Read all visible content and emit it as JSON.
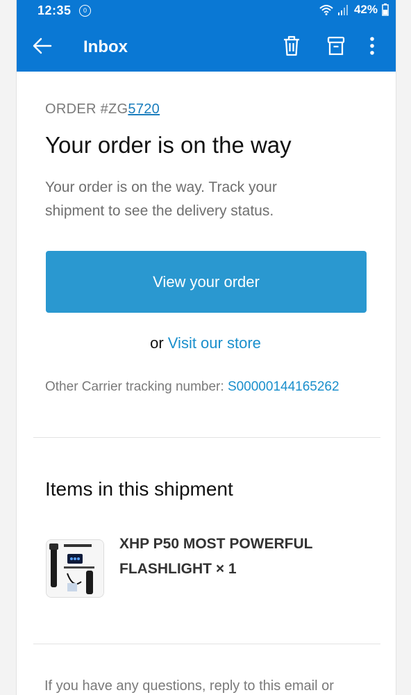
{
  "status_bar": {
    "time": "12:35",
    "notif_badge": "⓪",
    "battery": "42%"
  },
  "appbar": {
    "title": "Inbox",
    "color": "#0a78d4"
  },
  "email": {
    "order_prefix": "ORDER #ZG",
    "order_link": "5720",
    "headline": "Your order is on the way",
    "subtext": "Your order is on the way. Track your shipment to see the delivery status.",
    "button_label": "View your order",
    "or_text": "or",
    "store_link": "Visit our store",
    "tracking_label": "Other Carrier tracking number:",
    "tracking_number": "S00000144165262",
    "items_heading": "Items in this shipment",
    "item": {
      "name": "XHP P50 MOST POWERFUL FLASHLIGHT × 1"
    },
    "footer": "If you have any questions, reply to this email or"
  },
  "colors": {
    "accent_button": "#2a98d0",
    "link": "#1a8fcc"
  }
}
